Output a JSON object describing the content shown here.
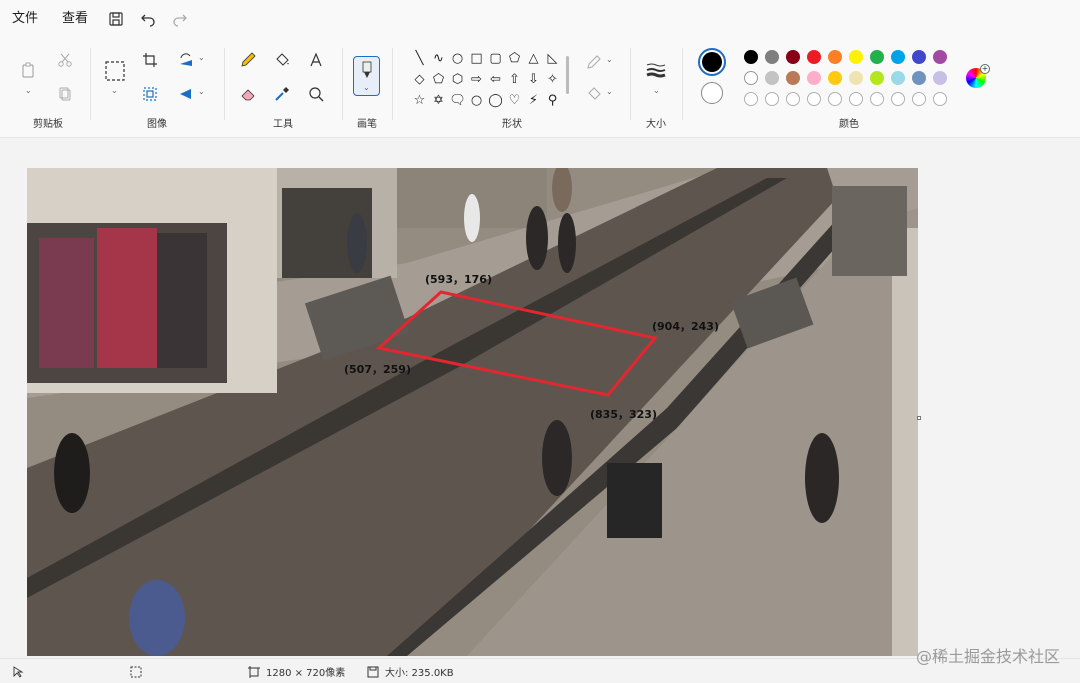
{
  "menu": {
    "file": "文件",
    "view": "查看"
  },
  "ribbon": {
    "groups": {
      "clipboard": "剪贴板",
      "image": "图像",
      "tools": "工具",
      "brushes": "画笔",
      "shapes": "形状",
      "size": "大小",
      "colors": "颜色"
    },
    "shapes": [
      "╲",
      "∿",
      "○",
      "□",
      "▢",
      "⬠",
      "△",
      "◺",
      "◇",
      "⬠",
      "⬡",
      "⇨",
      "⇦",
      "⇧",
      "⇩",
      "✧",
      "☆",
      "✡",
      "🗨",
      "○",
      "◯",
      "♡",
      "⚡",
      "⚲"
    ]
  },
  "palette": {
    "row1": [
      "#000000",
      "#7f7f7f",
      "#880015",
      "#ed1c24",
      "#ff7f27",
      "#fff200",
      "#22b14c",
      "#00a2e8",
      "#3f48cc",
      "#a349a4"
    ],
    "row2": [
      "#ffffff",
      "#c3c3c3",
      "#b97a57",
      "#ffaec9",
      "#ffc90e",
      "#efe4b0",
      "#b5e61d",
      "#99d9ea",
      "#7092be",
      "#c8bfe7"
    ],
    "primary": "#000000",
    "secondary": "#ffffff"
  },
  "annotations": {
    "p1": "(593，176)",
    "p2": "(904，243)",
    "p3": "(507，259)",
    "p4": "(835，323)",
    "polygon_color": "#e3262f"
  },
  "status": {
    "dimensions": "1280 × 720像素",
    "size": "大小: 235.0KB"
  },
  "watermark": "@稀土掘金技术社区"
}
